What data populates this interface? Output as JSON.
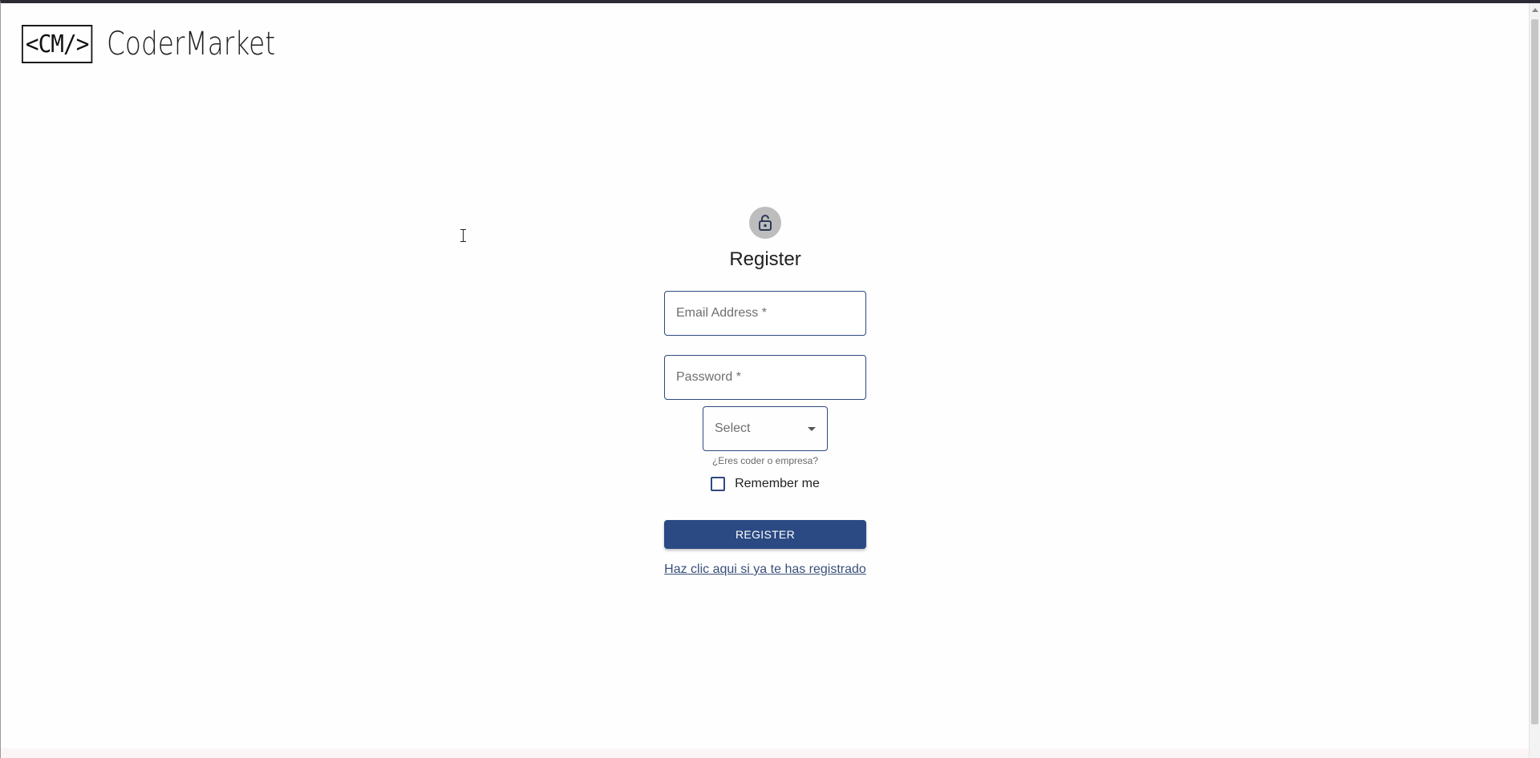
{
  "header": {
    "logo_mark": "<CM/>",
    "logo_text": "CoderMarket"
  },
  "form": {
    "title": "Register",
    "email_label": "Email Address *",
    "password_label": "Password *",
    "select_value": "Select",
    "select_helper": "¿Eres coder o empresa?",
    "remember_label": "Remember me",
    "remember_checked": false,
    "submit_label": "REGISTER",
    "login_link": "Haz clic aqui si ya te has registrado"
  },
  "colors": {
    "primary": "#2b4a83",
    "avatar_bg": "#bdbdbd"
  },
  "icons": {
    "avatar": "lock-open-icon",
    "select": "caret-down-icon"
  }
}
